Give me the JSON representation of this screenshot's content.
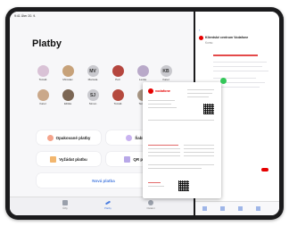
{
  "status_bar": {
    "time": "9:41",
    "date": "Úter 20. 9."
  },
  "page_title": "Platby",
  "contacts": [
    {
      "name": "Tomáš",
      "initials": "",
      "color": "#d9c2d6"
    },
    {
      "name": "Miroslav",
      "initials": "",
      "color": "#c7a27a"
    },
    {
      "name": "Marcela",
      "initials": "MV",
      "color": "#c9c9ce"
    },
    {
      "name": "Petr",
      "initials": "",
      "color": "#b5463f"
    },
    {
      "name": "Lenka",
      "initials": "",
      "color": "#b9a9c9"
    },
    {
      "name": "Karel",
      "initials": "KB",
      "color": "#c9c9ce"
    },
    {
      "name": "Karel",
      "initials": "",
      "color": "#caa88a"
    },
    {
      "name": "Eliška",
      "initials": "",
      "color": "#7b6654"
    },
    {
      "name": "Simon",
      "initials": "SJ",
      "color": "#c9c9ce"
    },
    {
      "name": "Tomáš",
      "initials": "",
      "color": "#b54a3e"
    },
    {
      "name": "Tereza",
      "initials": "",
      "color": "#a79583"
    }
  ],
  "actions": {
    "recurring": "Opakované platby",
    "templates": "Šablony",
    "request": "Vyžádat platbu",
    "qr": "QR platba",
    "new_payment": "Nová platba"
  },
  "tabs": {
    "left": "Účty",
    "middle": "Platby",
    "right": "Ostatní"
  },
  "mail": {
    "back": "‹",
    "sender": "Klientské centrum Vodafone",
    "to": "Komu:"
  },
  "invoice": {
    "brand": "vodafone"
  },
  "colors": {
    "accent": "#4a7de0",
    "red": "#e60000",
    "green": "#34c759"
  }
}
